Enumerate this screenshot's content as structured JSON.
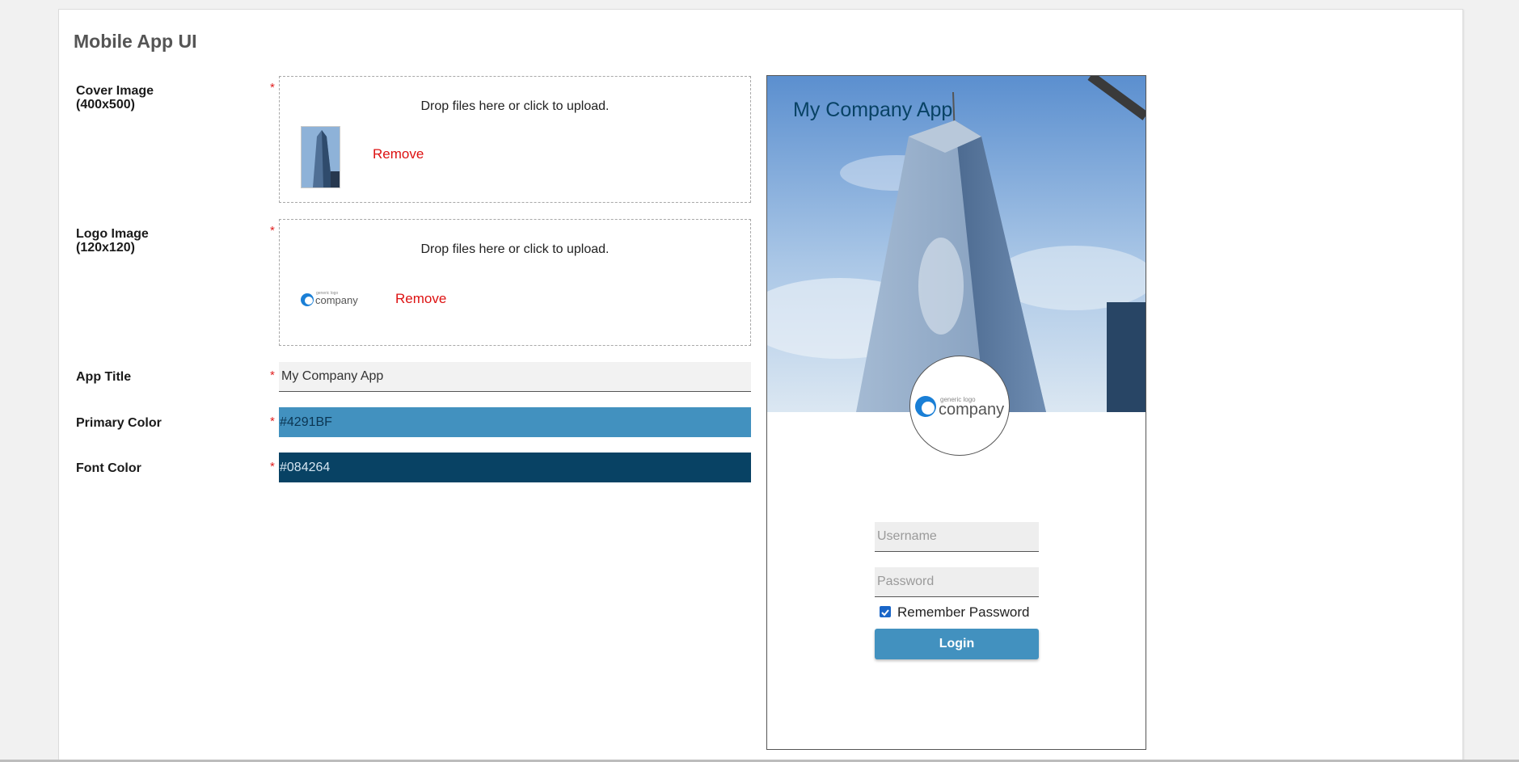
{
  "page": {
    "title": "Mobile App UI"
  },
  "form": {
    "cover_image": {
      "label": "Cover Image",
      "sublabel": "(400x500)",
      "required_mark": "*",
      "dropzone_message": "Drop files here or click to upload.",
      "remove_label": "Remove"
    },
    "logo_image": {
      "label": "Logo Image",
      "sublabel": "(120x120)",
      "required_mark": "*",
      "dropzone_message": "Drop files here or click to upload.",
      "remove_label": "Remove"
    },
    "app_title": {
      "label": "App Title",
      "required_mark": "*",
      "value": "My Company App"
    },
    "primary_color": {
      "label": "Primary Color",
      "required_mark": "*",
      "value": "#4291BF"
    },
    "font_color": {
      "label": "Font Color",
      "required_mark": "*",
      "value": "#084264"
    }
  },
  "logo": {
    "small_text": "generic logo",
    "company_text": "company"
  },
  "preview": {
    "title": "My Company App",
    "username_placeholder": "Username",
    "password_placeholder": "Password",
    "remember_label": "Remember Password",
    "remember_checked": true,
    "login_label": "Login"
  },
  "colors": {
    "primary": "#4291BF",
    "font": "#084264",
    "remove": "#dd1111",
    "required": "#e02020"
  }
}
